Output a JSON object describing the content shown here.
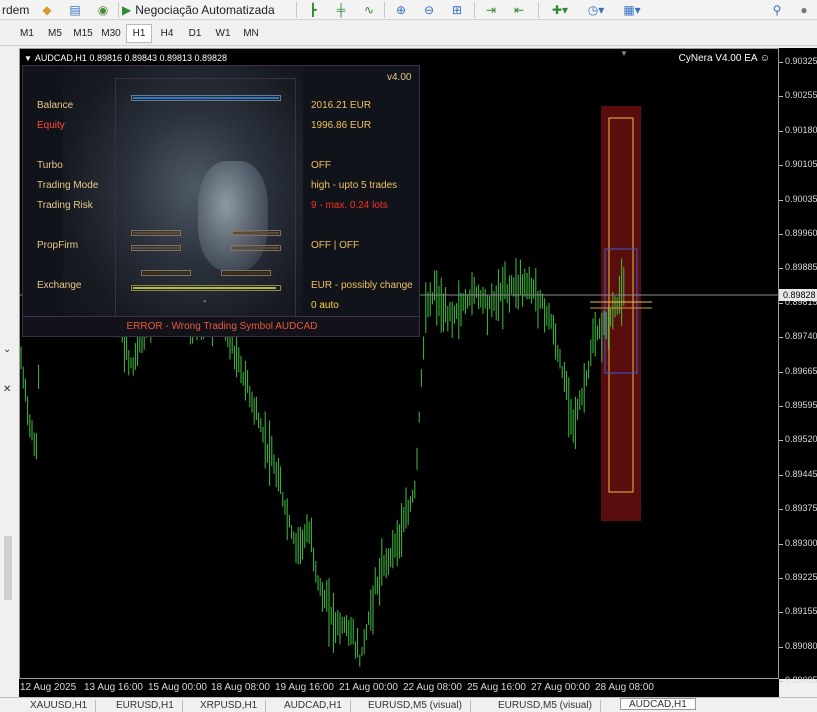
{
  "toolbar": {
    "left_fragment": "rdem",
    "autotrading_label": "Negociação Automatizada"
  },
  "timeframes": [
    "M1",
    "M5",
    "M15",
    "M30",
    "H1",
    "H4",
    "D1",
    "W1",
    "MN"
  ],
  "active_timeframe": "H1",
  "chart": {
    "title": "AUDCAD,H1  0.89816 0.89843 0.89813 0.89828",
    "ea_name": "CyNera V4.00 EA ☺",
    "current_price": "0.89828",
    "price_ticks": [
      "0.90325",
      "0.90255",
      "0.90180",
      "0.90105",
      "0.90035",
      "0.89960",
      "0.89885",
      "0.89815",
      "0.89740",
      "0.89665",
      "0.89595",
      "0.89520",
      "0.89445",
      "0.89375",
      "0.89300",
      "0.89225",
      "0.89155",
      "0.89080",
      "0.89005"
    ],
    "time_ticks": [
      "12 Aug 2025",
      "13 Aug 16:00",
      "15 Aug 00:00",
      "18 Aug 08:00",
      "19 Aug 16:00",
      "21 Aug 00:00",
      "22 Aug 08:00",
      "25 Aug 16:00",
      "27 Aug 00:00",
      "28 Aug 08:00"
    ],
    "colors": {
      "candles": "#3fbf3f",
      "background": "#000000",
      "zone": "#5a0d0d"
    }
  },
  "dashboard": {
    "version": "v4.00",
    "balance_label": "Balance",
    "balance_value": "2016.21 EUR",
    "equity_label": "Equity",
    "equity_value": "1996.86 EUR",
    "turbo_label": "Turbo",
    "turbo_value": "OFF",
    "mode_label": "Trading Mode",
    "mode_value": "high - upto 5 trades",
    "risk_label": "Trading Risk",
    "risk_value": "9 - max. 0.24 lots",
    "propfirm_label": "PropFirm",
    "propfirm_value": "OFF | OFF",
    "exchange_label": "Exchange",
    "exchange_value": "EUR - possibly change",
    "auto_value": "0 auto",
    "dash_mark": "-",
    "error": "ERROR - Wrong Trading Symbol AUDCAD"
  },
  "tabs": [
    "XAUUSD,H1",
    "EURUSD,H1",
    "XRPUSD,H1",
    "AUDCAD,H1",
    "EURUSD,M5 (visual)",
    "EURUSD,M5 (visual)",
    "AUDCAD,H1"
  ],
  "active_tab_index": 6
}
